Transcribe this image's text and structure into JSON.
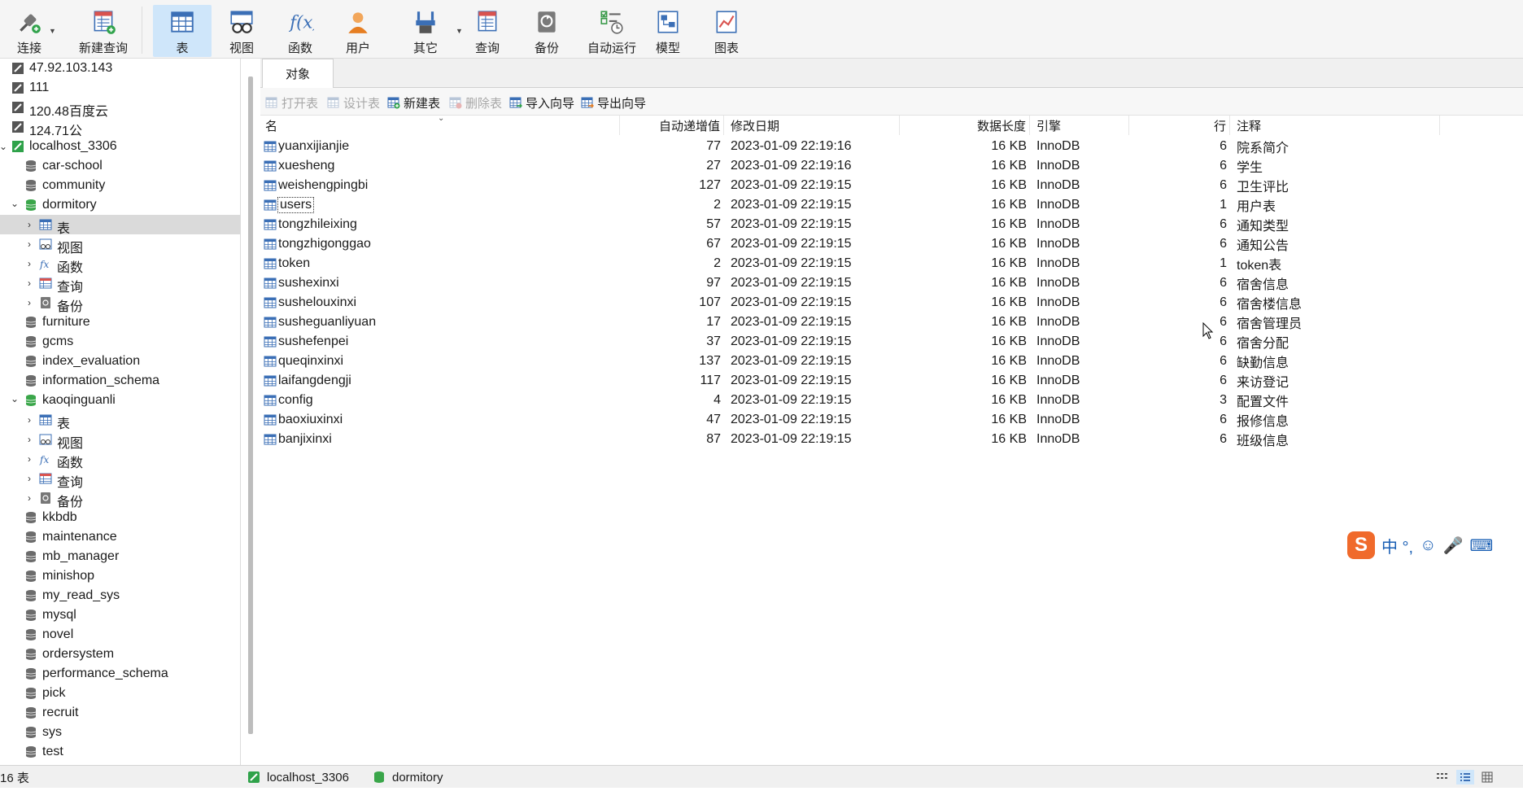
{
  "toolbar": {
    "items": [
      {
        "id": "connect",
        "label": "连接",
        "icon": "plug-icon",
        "has_dropdown": true
      },
      {
        "id": "new-query",
        "label": "新建查询",
        "icon": "new-query-icon",
        "has_dropdown": false
      },
      {
        "id": "table",
        "label": "表",
        "icon": "table-icon",
        "active": true
      },
      {
        "id": "view",
        "label": "视图",
        "icon": "view-icon"
      },
      {
        "id": "function",
        "label": "函数",
        "icon": "function-icon"
      },
      {
        "id": "user",
        "label": "用户",
        "icon": "user-icon"
      },
      {
        "id": "other",
        "label": "其它",
        "icon": "tools-icon",
        "has_dropdown": true
      },
      {
        "id": "query",
        "label": "查询",
        "icon": "query-icon"
      },
      {
        "id": "backup",
        "label": "备份",
        "icon": "backup-icon"
      },
      {
        "id": "autorun",
        "label": "自动运行",
        "icon": "autorun-icon"
      },
      {
        "id": "model",
        "label": "模型",
        "icon": "model-icon"
      },
      {
        "id": "chart",
        "label": "图表",
        "icon": "chart-icon"
      }
    ]
  },
  "tree": [
    {
      "label": "47.92.103.143",
      "type": "connection",
      "level": 0
    },
    {
      "label": "111",
      "type": "connection",
      "level": 0
    },
    {
      "label": "120.48百度云",
      "type": "connection",
      "level": 0
    },
    {
      "label": "124.71公",
      "type": "connection",
      "level": 0
    },
    {
      "label": "localhost_3306",
      "type": "connection-open",
      "level": 0,
      "expanded": true
    },
    {
      "label": "car-school",
      "type": "database",
      "level": 1
    },
    {
      "label": "community",
      "type": "database",
      "level": 1
    },
    {
      "label": "dormitory",
      "type": "database-open",
      "level": 1,
      "expanded": true
    },
    {
      "label": "表",
      "type": "tables",
      "level": 2,
      "selected": true
    },
    {
      "label": "视图",
      "type": "views",
      "level": 2
    },
    {
      "label": "函数",
      "type": "functions",
      "level": 2
    },
    {
      "label": "查询",
      "type": "queries",
      "level": 2
    },
    {
      "label": "备份",
      "type": "backups",
      "level": 2
    },
    {
      "label": "furniture",
      "type": "database",
      "level": 1
    },
    {
      "label": "gcms",
      "type": "database",
      "level": 1
    },
    {
      "label": "index_evaluation",
      "type": "database",
      "level": 1
    },
    {
      "label": "information_schema",
      "type": "database",
      "level": 1
    },
    {
      "label": "kaoqinguanli",
      "type": "database-open",
      "level": 1,
      "expanded": true
    },
    {
      "label": "表",
      "type": "tables",
      "level": 2
    },
    {
      "label": "视图",
      "type": "views",
      "level": 2
    },
    {
      "label": "函数",
      "type": "functions",
      "level": 2
    },
    {
      "label": "查询",
      "type": "queries",
      "level": 2
    },
    {
      "label": "备份",
      "type": "backups",
      "level": 2
    },
    {
      "label": "kkbdb",
      "type": "database",
      "level": 1
    },
    {
      "label": "maintenance",
      "type": "database",
      "level": 1
    },
    {
      "label": "mb_manager",
      "type": "database",
      "level": 1
    },
    {
      "label": "minishop",
      "type": "database",
      "level": 1
    },
    {
      "label": "my_read_sys",
      "type": "database",
      "level": 1
    },
    {
      "label": "mysql",
      "type": "database",
      "level": 1
    },
    {
      "label": "novel",
      "type": "database",
      "level": 1
    },
    {
      "label": "ordersystem",
      "type": "database",
      "level": 1
    },
    {
      "label": "performance_schema",
      "type": "database",
      "level": 1
    },
    {
      "label": "pick",
      "type": "database",
      "level": 1
    },
    {
      "label": "recruit",
      "type": "database",
      "level": 1
    },
    {
      "label": "sys",
      "type": "database",
      "level": 1
    },
    {
      "label": "test",
      "type": "database",
      "level": 1
    }
  ],
  "tabs": {
    "objects": "对象"
  },
  "object_toolbar": [
    {
      "label": "打开表",
      "icon": "open-table-icon",
      "enabled": false
    },
    {
      "label": "设计表",
      "icon": "design-table-icon",
      "enabled": false
    },
    {
      "label": "新建表",
      "icon": "new-table-icon",
      "enabled": true
    },
    {
      "label": "删除表",
      "icon": "delete-table-icon",
      "enabled": false
    },
    {
      "label": "导入向导",
      "icon": "import-wizard-icon",
      "enabled": true
    },
    {
      "label": "导出向导",
      "icon": "export-wizard-icon",
      "enabled": true
    }
  ],
  "table": {
    "columns": [
      "名",
      "自动递增值",
      "修改日期",
      "数据长度",
      "引擎",
      "行",
      "注释"
    ],
    "rows": [
      {
        "name": "yuanxijianjie",
        "auto_inc": "77",
        "modified": "2023-01-09 22:19:16",
        "length": "16 KB",
        "engine": "InnoDB",
        "rows": "6",
        "comment": "院系简介"
      },
      {
        "name": "xuesheng",
        "auto_inc": "27",
        "modified": "2023-01-09 22:19:16",
        "length": "16 KB",
        "engine": "InnoDB",
        "rows": "6",
        "comment": "学生"
      },
      {
        "name": "weishengpingbi",
        "auto_inc": "127",
        "modified": "2023-01-09 22:19:15",
        "length": "16 KB",
        "engine": "InnoDB",
        "rows": "6",
        "comment": "卫生评比"
      },
      {
        "name": "users",
        "auto_inc": "2",
        "modified": "2023-01-09 22:19:15",
        "length": "16 KB",
        "engine": "InnoDB",
        "rows": "1",
        "comment": "用户表",
        "focused": true
      },
      {
        "name": "tongzhileixing",
        "auto_inc": "57",
        "modified": "2023-01-09 22:19:15",
        "length": "16 KB",
        "engine": "InnoDB",
        "rows": "6",
        "comment": "通知类型"
      },
      {
        "name": "tongzhigonggao",
        "auto_inc": "67",
        "modified": "2023-01-09 22:19:15",
        "length": "16 KB",
        "engine": "InnoDB",
        "rows": "6",
        "comment": "通知公告"
      },
      {
        "name": "token",
        "auto_inc": "2",
        "modified": "2023-01-09 22:19:15",
        "length": "16 KB",
        "engine": "InnoDB",
        "rows": "1",
        "comment": "token表"
      },
      {
        "name": "sushexinxi",
        "auto_inc": "97",
        "modified": "2023-01-09 22:19:15",
        "length": "16 KB",
        "engine": "InnoDB",
        "rows": "6",
        "comment": "宿舍信息"
      },
      {
        "name": "sushelouxinxi",
        "auto_inc": "107",
        "modified": "2023-01-09 22:19:15",
        "length": "16 KB",
        "engine": "InnoDB",
        "rows": "6",
        "comment": "宿舍楼信息"
      },
      {
        "name": "susheguanliyuan",
        "auto_inc": "17",
        "modified": "2023-01-09 22:19:15",
        "length": "16 KB",
        "engine": "InnoDB",
        "rows": "6",
        "comment": "宿舍管理员"
      },
      {
        "name": "sushefenpei",
        "auto_inc": "37",
        "modified": "2023-01-09 22:19:15",
        "length": "16 KB",
        "engine": "InnoDB",
        "rows": "6",
        "comment": "宿舍分配"
      },
      {
        "name": "queqinxinxi",
        "auto_inc": "137",
        "modified": "2023-01-09 22:19:15",
        "length": "16 KB",
        "engine": "InnoDB",
        "rows": "6",
        "comment": "缺勤信息"
      },
      {
        "name": "laifangdengji",
        "auto_inc": "117",
        "modified": "2023-01-09 22:19:15",
        "length": "16 KB",
        "engine": "InnoDB",
        "rows": "6",
        "comment": "来访登记"
      },
      {
        "name": "config",
        "auto_inc": "4",
        "modified": "2023-01-09 22:19:15",
        "length": "16 KB",
        "engine": "InnoDB",
        "rows": "3",
        "comment": "配置文件"
      },
      {
        "name": "baoxiuxinxi",
        "auto_inc": "47",
        "modified": "2023-01-09 22:19:15",
        "length": "16 KB",
        "engine": "InnoDB",
        "rows": "6",
        "comment": "报修信息"
      },
      {
        "name": "banjixinxi",
        "auto_inc": "87",
        "modified": "2023-01-09 22:19:15",
        "length": "16 KB",
        "engine": "InnoDB",
        "rows": "6",
        "comment": "班级信息"
      }
    ]
  },
  "statusbar": {
    "count": "16 表",
    "connection": "localhost_3306",
    "database": "dormitory"
  },
  "ime": {
    "label": "中 °,"
  },
  "colors": {
    "accent": "#cfe6fa",
    "db_open": "#3aa64a",
    "conn_green": "#2fa24a",
    "icon_blue": "#3b6fb6"
  }
}
